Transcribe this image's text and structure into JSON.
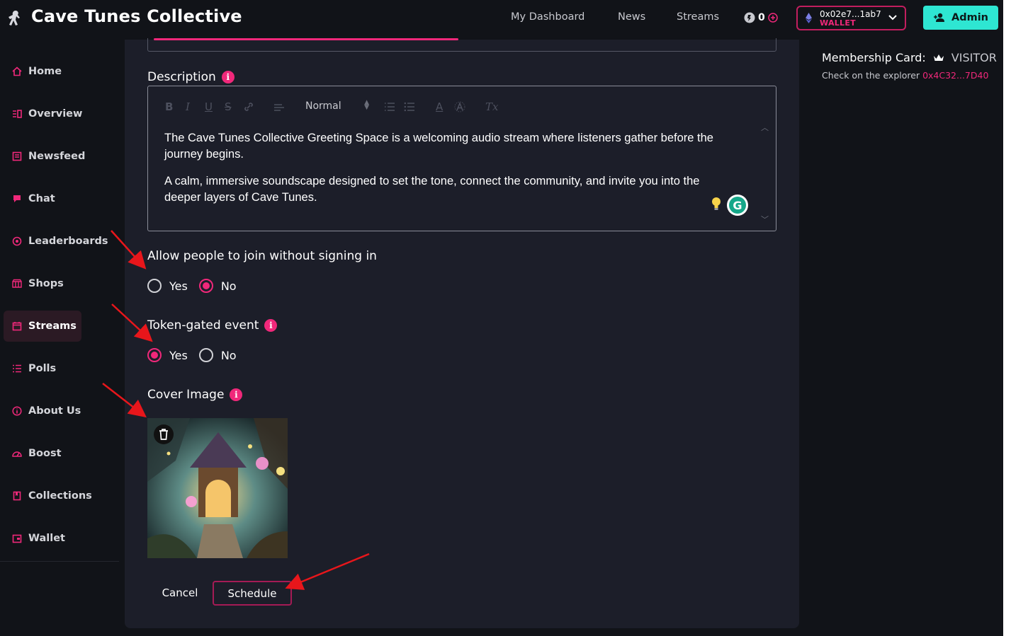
{
  "header": {
    "title": "Cave Tunes Collective",
    "nav": [
      {
        "label": "My Dashboard"
      },
      {
        "label": "News"
      },
      {
        "label": "Streams"
      }
    ],
    "coin_balance": "0",
    "wallet_address": "0x02e7...1ab7",
    "wallet_tag": "WALLET",
    "admin_label": "Admin"
  },
  "sidebar": {
    "items": [
      {
        "label": "Home",
        "icon": "home-icon"
      },
      {
        "label": "Overview",
        "icon": "overview-icon"
      },
      {
        "label": "Newsfeed",
        "icon": "newsfeed-icon"
      },
      {
        "label": "Chat",
        "icon": "chat-icon"
      },
      {
        "label": "Leaderboards",
        "icon": "leaderboard-icon"
      },
      {
        "label": "Shops",
        "icon": "shop-icon"
      },
      {
        "label": "Streams",
        "icon": "calendar-icon",
        "active": true
      },
      {
        "label": "Polls",
        "icon": "polls-icon"
      },
      {
        "label": "About Us",
        "icon": "info-icon"
      },
      {
        "label": "Boost",
        "icon": "boost-icon"
      },
      {
        "label": "Collections",
        "icon": "collections-icon"
      },
      {
        "label": "Wallet",
        "icon": "wallet-icon"
      }
    ]
  },
  "form": {
    "description_label": "Description",
    "toolbar": {
      "bold": "B",
      "italic": "I",
      "underline": "U",
      "strike": "S",
      "font_size": "Normal",
      "clear": "Tx",
      "color": "A"
    },
    "description_paragraphs": [
      "The Cave Tunes Collective Greeting Space is a welcoming audio stream where listeners gather before the journey begins.",
      "A calm, immersive soundscape designed to set the tone, connect the community, and invite you into the deeper layers of Cave Tunes."
    ],
    "allow_join_label": "Allow people to join without signing in",
    "allow_join_options": [
      "Yes",
      "No"
    ],
    "allow_join_selected": "No",
    "token_gated_label": "Token-gated event",
    "token_gated_options": [
      "Yes",
      "No"
    ],
    "token_gated_selected": "Yes",
    "cover_label": "Cover Image",
    "cancel_label": "Cancel",
    "schedule_label": "Schedule"
  },
  "membership": {
    "label": "Membership Card:",
    "value": "VISITOR",
    "explorer_text": "Check on the explorer",
    "explorer_link": "0x4C32...7D40"
  },
  "colors": {
    "accent": "#f0287a",
    "admin": "#2ee6d2",
    "background": "#111318",
    "panel": "#1c1e29",
    "annotation_arrow": "#e8161b"
  }
}
